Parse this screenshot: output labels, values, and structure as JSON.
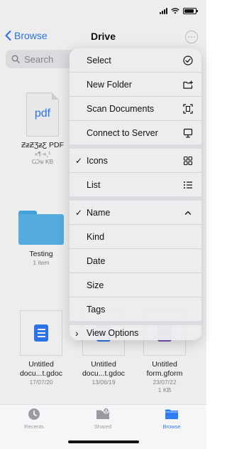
{
  "nav": {
    "back_label": "Browse",
    "title": "Drive"
  },
  "search": {
    "placeholder": "Search"
  },
  "files": [
    {
      "name": "ƵƶƵƷƶƸ PDF",
      "meta1": "«¶·«¸¹",
      "meta2": "Ѡѡ KB",
      "type": "pdf"
    },
    {
      "name": "Testing",
      "meta1": "1 item",
      "type": "folder"
    },
    {
      "name": "Untitled docu...t.gdoc",
      "meta1": "17/07/20",
      "type": "gdoc"
    },
    {
      "name": "Untitled docu...t.gdoc",
      "meta1": "13/06/19",
      "type": "gdoc"
    },
    {
      "name": "Untitled form.gform",
      "meta1": "23/07/22",
      "meta2": "1 KB",
      "type": "gform"
    }
  ],
  "pdf_thumb_label": "pdf",
  "menu": {
    "actions": [
      {
        "label": "Select",
        "icon": "checkmark-circle-icon"
      },
      {
        "label": "New Folder",
        "icon": "folder-badge-plus-icon"
      },
      {
        "label": "Scan Documents",
        "icon": "doc-viewfinder-icon"
      },
      {
        "label": "Connect to Server",
        "icon": "display-icon"
      }
    ],
    "view_modes": [
      {
        "label": "Icons",
        "checked": true,
        "icon": "square-grid-icon"
      },
      {
        "label": "List",
        "checked": false,
        "icon": "list-bullet-icon"
      }
    ],
    "sort": [
      {
        "label": "Name",
        "checked": true,
        "icon": "chevron-up-icon"
      },
      {
        "label": "Kind"
      },
      {
        "label": "Date"
      },
      {
        "label": "Size"
      },
      {
        "label": "Tags"
      }
    ],
    "view_options": {
      "label": "View Options"
    },
    "check_glyph": "✓",
    "chevron_glyph": "›"
  },
  "tabs": [
    {
      "label": "Recents",
      "active": false,
      "icon": "clock-icon"
    },
    {
      "label": "Shared",
      "active": false,
      "icon": "shared-folder-icon"
    },
    {
      "label": "Browse",
      "active": true,
      "icon": "folder-fill-icon"
    }
  ],
  "colors": {
    "accent": "#2f7cf6",
    "folder": "#5ab9ef",
    "menu_bg": "#ececf0"
  }
}
